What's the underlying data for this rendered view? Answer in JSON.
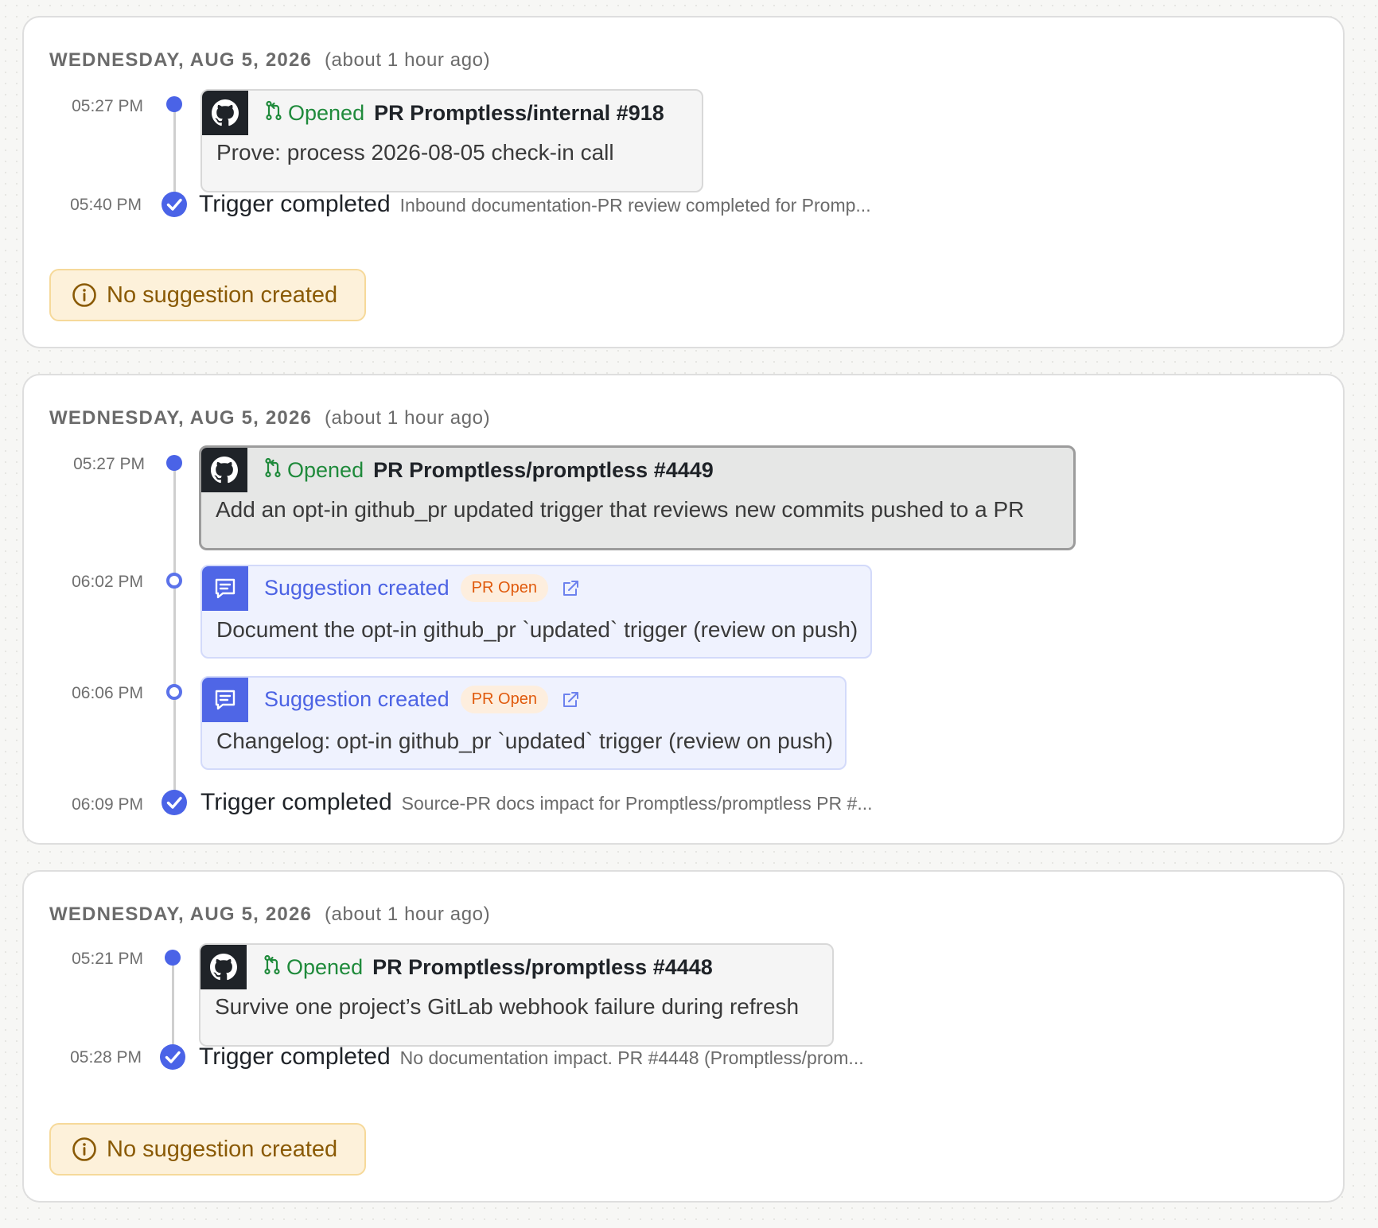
{
  "colors": {
    "accent": "#4a63e7",
    "opened_green": "#1f8a3b",
    "badge_text": "#e05a0c",
    "warning_text": "#8a5a05"
  },
  "cards": [
    {
      "date": "WEDNESDAY, AUG 5, 2026",
      "relative": "(about 1 hour ago)",
      "events": [
        {
          "time": "05:27 PM",
          "icon": "github-icon",
          "action_icon": "pull-request-icon",
          "action": "Opened",
          "pr": "PR Promptless/internal #918",
          "body": "Prove: process 2026-08-05 check-in call"
        }
      ],
      "trigger": {
        "time": "05:40 PM",
        "title": "Trigger completed",
        "detail": "Inbound documentation-PR review completed for Promp..."
      },
      "notice": {
        "icon": "info-icon",
        "label": "No suggestion created"
      }
    },
    {
      "date": "WEDNESDAY, AUG 5, 2026",
      "relative": "(about 1 hour ago)",
      "events": [
        {
          "time": "05:27 PM",
          "icon": "github-icon",
          "action_icon": "pull-request-icon",
          "action": "Opened",
          "pr": "PR Promptless/promptless #4449",
          "body": "Add an opt-in github_pr updated trigger that reviews new commits pushed to a PR"
        },
        {
          "time": "06:02 PM",
          "icon": "comment-icon",
          "title": "Suggestion created",
          "badge": "PR Open",
          "link_icon": "external-link-icon",
          "body": "Document the opt-in github_pr `updated` trigger (review on push)"
        },
        {
          "time": "06:06 PM",
          "icon": "comment-icon",
          "title": "Suggestion created",
          "badge": "PR Open",
          "link_icon": "external-link-icon",
          "body": "Changelog: opt-in github_pr `updated` trigger (review on push)"
        }
      ],
      "trigger": {
        "time": "06:09 PM",
        "title": "Trigger completed",
        "detail": "Source-PR docs impact for Promptless/promptless PR #..."
      }
    },
    {
      "date": "WEDNESDAY, AUG 5, 2026",
      "relative": "(about 1 hour ago)",
      "events": [
        {
          "time": "05:21 PM",
          "icon": "github-icon",
          "action_icon": "pull-request-icon",
          "action": "Opened",
          "pr": "PR Promptless/promptless #4448",
          "body": "Survive one project’s GitLab webhook failure during refresh"
        }
      ],
      "trigger": {
        "time": "05:28 PM",
        "title": "Trigger completed",
        "detail": "No documentation impact. PR #4448 (Promptless/prom..."
      },
      "notice": {
        "icon": "info-icon",
        "label": "No suggestion created"
      }
    }
  ]
}
